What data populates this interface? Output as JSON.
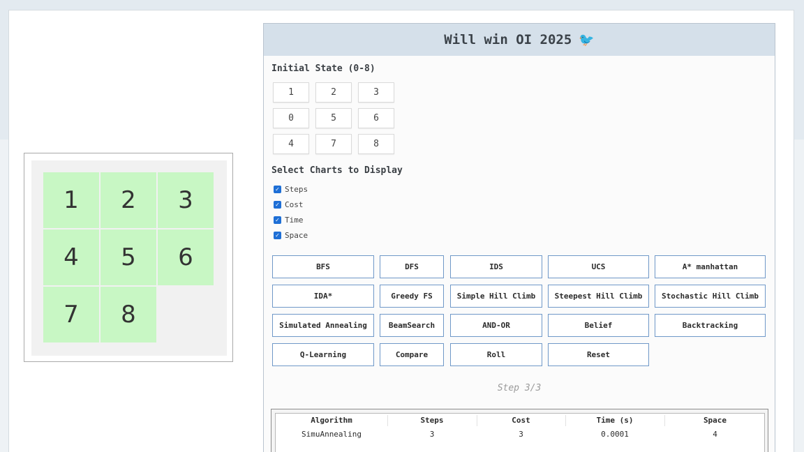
{
  "board": {
    "tiles": [
      {
        "label": "1",
        "row": 0,
        "col": 0
      },
      {
        "label": "2",
        "row": 0,
        "col": 1
      },
      {
        "label": "3",
        "row": 0,
        "col": 2
      },
      {
        "label": "4",
        "row": 1,
        "col": 0
      },
      {
        "label": "5",
        "row": 1,
        "col": 1
      },
      {
        "label": "6",
        "row": 1,
        "col": 2
      },
      {
        "label": "7",
        "row": 2,
        "col": 0
      },
      {
        "label": "8",
        "row": 2,
        "col": 1
      }
    ]
  },
  "panel": {
    "title": "Will win OI 2025",
    "title_icon": "🐦",
    "initial_state_label": "Initial State (0-8)",
    "initial_state": [
      "1",
      "2",
      "3",
      "0",
      "5",
      "6",
      "4",
      "7",
      "8"
    ],
    "charts_label": "Select Charts to Display",
    "charts": [
      {
        "label": "Steps",
        "checked": true
      },
      {
        "label": "Cost",
        "checked": true
      },
      {
        "label": "Time",
        "checked": true
      },
      {
        "label": "Space",
        "checked": true
      }
    ],
    "buttons": [
      [
        "BFS",
        "DFS",
        "IDS",
        "UCS",
        "A* manhattan"
      ],
      [
        "IDA*",
        "Greedy FS",
        "Simple Hill Climb",
        "Steepest Hill Climb",
        "Stochastic Hill Climb"
      ],
      [
        "Simulated Annealing",
        "BeamSearch",
        "AND-OR",
        "Belief",
        "Backtracking"
      ],
      [
        "Q-Learning",
        "Compare",
        "Roll",
        "Reset"
      ]
    ],
    "step_text": "Step 3/3",
    "results": {
      "headers": [
        "Algorithm",
        "Steps",
        "Cost",
        "Time (s)",
        "Space"
      ],
      "rows": [
        [
          "SimuAnnealing",
          "3",
          "3",
          "0.0001",
          "4"
        ]
      ]
    }
  },
  "colors": {
    "tile": "#c8f7c4",
    "header_bg": "#d5e0ea",
    "button_border": "#6f98c8",
    "checkbox": "#1e6fd6"
  }
}
